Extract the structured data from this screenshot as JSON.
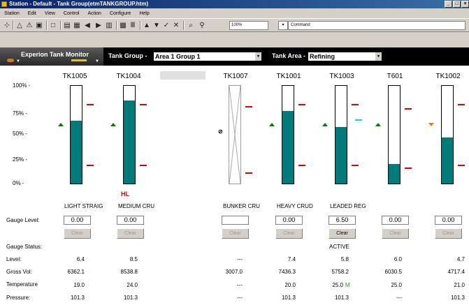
{
  "window": {
    "title": "Station - Default - Tank Group(etmTANKGROUP.htm)",
    "controls": [
      "_",
      "□",
      "×"
    ]
  },
  "menu": [
    "Station",
    "Edit",
    "View",
    "Control",
    "Action",
    "Configure",
    "Help"
  ],
  "toolbar": {
    "zoom": "100%",
    "zoom_dd": "▾",
    "command_label": "Command"
  },
  "header": {
    "brand": "Experion Tank Monitor",
    "group_label": "Tank Group -",
    "group_value": "Area 1 Group 1",
    "area_label": "Tank Area -",
    "area_value": "Refining",
    "dd": "▾"
  },
  "y_axis": [
    "100% -",
    "75% -",
    "50% -",
    "25% -",
    "0%  -"
  ],
  "labels": {
    "gauge_level": "Gauge Level:",
    "gauge_status": "Gauge Status:",
    "level": "Level:",
    "gross_vol": "Gross Vol:",
    "temperature": "Temperature",
    "pressure": "Pressure:",
    "hl": "HL",
    "clear": "Clear"
  },
  "tanks": [
    {
      "name": "TK1005",
      "product": "LIGHT STRAIG",
      "fill_pct": 64,
      "gauge": "0.00",
      "status": "",
      "level": "6.4",
      "gross_vol": "6362.1",
      "temperature": "19.0",
      "temp_flag": "",
      "pressure": "101.3"
    },
    {
      "name": "TK1004",
      "product": "MEDIUM CRU",
      "fill_pct": 85,
      "gauge": "0.00",
      "status": "",
      "level": "8.5",
      "gross_vol": "8538.8",
      "temperature": "24.0",
      "temp_flag": "",
      "pressure": "101.3"
    },
    {
      "name": "TK1007",
      "product": "BUNKER CRU",
      "fill_pct": 0,
      "gauge": "",
      "status": "",
      "level": "---",
      "gross_vol": "3007.0",
      "temperature": "---",
      "temp_flag": "",
      "pressure": "---"
    },
    {
      "name": "TK1001",
      "product": "HEAVY CRUD",
      "fill_pct": 74,
      "gauge": "0.00",
      "status": "",
      "level": "7.4",
      "gross_vol": "7436.3",
      "temperature": "20.0",
      "temp_flag": "",
      "pressure": "101.3"
    },
    {
      "name": "TK1003",
      "product": "LEADED REG",
      "fill_pct": 58,
      "gauge": "6.50",
      "status": "ACTIVE",
      "level": "5.8",
      "gross_vol": "5758.2",
      "temperature": "25.0",
      "temp_flag": "M",
      "pressure": "101.3"
    },
    {
      "name": "T601",
      "product": "",
      "fill_pct": 20,
      "gauge": "0.00",
      "status": "",
      "level": "6.0",
      "gross_vol": "6030.5",
      "temperature": "25.0",
      "temp_flag": "",
      "pressure": "---"
    },
    {
      "name": "TK1002",
      "product": "",
      "fill_pct": 47,
      "gauge": "0.00",
      "status": "",
      "level": "4.7",
      "gross_vol": "4717.4",
      "temperature": "21.0",
      "temp_flag": "",
      "pressure": "101.3"
    }
  ],
  "colors": {
    "fill": "#007b7b",
    "alarm": "#e00000",
    "active_alarm": "#00e0e0",
    "trend_up": "#008000",
    "trend_warn": "#e08000"
  }
}
